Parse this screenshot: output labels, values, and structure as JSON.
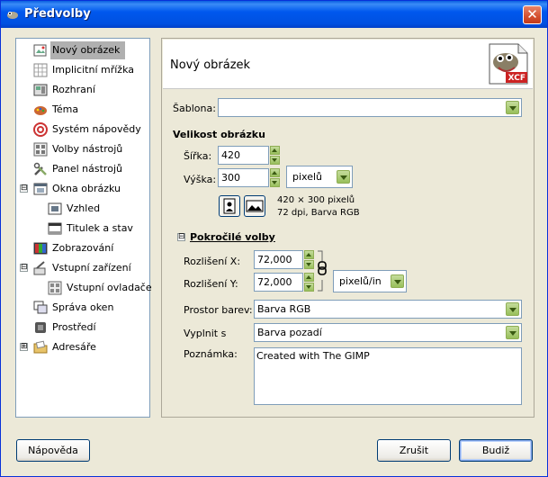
{
  "window": {
    "title": "Předvolby",
    "close_glyph": "✕"
  },
  "sidebar": {
    "items": [
      {
        "label": "Nový obrázek",
        "icon": "new-image-icon",
        "selected": true
      },
      {
        "label": "Implicitní mřížka",
        "icon": "grid-icon"
      },
      {
        "label": "Rozhraní",
        "icon": "interface-icon"
      },
      {
        "label": "Téma",
        "icon": "theme-icon"
      },
      {
        "label": "Systém nápovědy",
        "icon": "help-system-icon"
      },
      {
        "label": "Volby nástrojů",
        "icon": "tool-options-icon"
      },
      {
        "label": "Panel nástrojů",
        "icon": "toolbox-icon"
      },
      {
        "label": "Okna obrázku",
        "icon": "image-windows-icon",
        "expander": "⊟"
      },
      {
        "label": "Vzhled",
        "icon": "appearance-icon"
      },
      {
        "label": "Titulek a stav",
        "icon": "title-status-icon"
      },
      {
        "label": "Zobrazování",
        "icon": "display-icon"
      },
      {
        "label": "Vstupní zařízení",
        "icon": "input-devices-icon",
        "expander": "⊟"
      },
      {
        "label": "Vstupní ovladače",
        "icon": "input-controllers-icon"
      },
      {
        "label": "Správa oken",
        "icon": "window-management-icon"
      },
      {
        "label": "Prostředí",
        "icon": "environment-icon"
      },
      {
        "label": "Adresáře",
        "icon": "folders-icon",
        "expander": "⊞"
      }
    ]
  },
  "panel": {
    "title": "Nový obrázek",
    "icon": "xcf-file-icon",
    "xcf_badge": "XCF",
    "template": {
      "label": "Šablona:",
      "value": ""
    },
    "image_size": {
      "heading": "Velikost obrázku",
      "width_label": "Šířka:",
      "width_value": "420",
      "height_label": "Výška:",
      "height_value": "300",
      "unit": "pixelů",
      "info_line1": "420 × 300 pixelů",
      "info_line2": "72 dpi, Barva RGB"
    },
    "advanced": {
      "heading": "Pokročilé volby",
      "expander": "⊟",
      "xres_label": "Rozlišení X:",
      "xres_value": "72,000",
      "yres_label": "Rozlišení Y:",
      "yres_value": "72,000",
      "res_unit": "pixelů/in",
      "colorspace_label": "Prostor barev:",
      "colorspace_value": "Barva RGB",
      "fill_label": "Vyplnit s",
      "fill_value": "Barva pozadí",
      "comment_label": "Poznámka:",
      "comment_value": "Created with The GIMP"
    }
  },
  "buttons": {
    "help": "Nápověda",
    "cancel": "Zrušit",
    "ok": "Budiž"
  },
  "colors": {
    "titlebar": "#0058ee",
    "selection": "#b0b0b0",
    "accent_green": "#98bf5b"
  }
}
